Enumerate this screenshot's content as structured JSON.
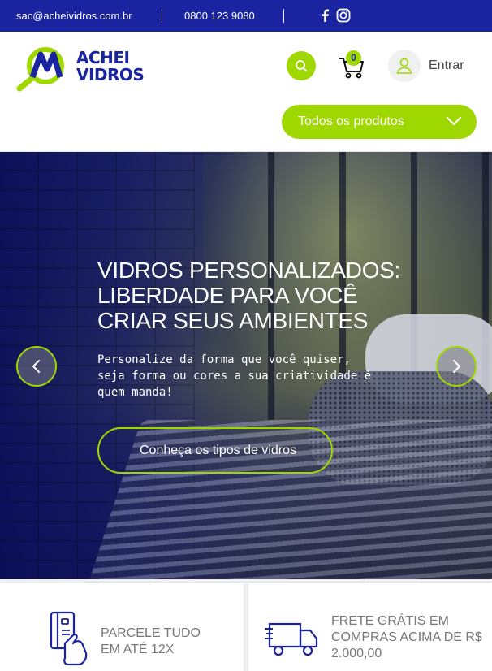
{
  "topbar": {
    "email": "sac@acheividros.com.br",
    "phone": "0800 123 9080",
    "social": [
      "facebook-icon",
      "instagram-icon"
    ]
  },
  "header": {
    "logo_text_line1": "ACHEI",
    "logo_text_line2": "VIDROS",
    "cart_count": "0",
    "login_label": "Entrar",
    "products_button_label": "Todos os produtos"
  },
  "hero": {
    "title": "VIDROS PERSONALIZADOS: LIBERDADE PARA VOCÊ CRIAR SEUS AMBIENTES",
    "subtitle": "Personalize da forma que você quiser, seja forma ou cores a sua criatividade é quem manda!",
    "cta_label": "Conheça os tipos de vidros"
  },
  "benefits": [
    {
      "icon": "card-in-hand-icon",
      "text": "PARCELE TUDO EM ATÉ 12X"
    },
    {
      "icon": "delivery-truck-icon",
      "text": "FRETE GRÁTIS EM COMPRAS ACIMA DE R$ 2.000,00"
    }
  ],
  "colors": {
    "brand_blue": "#1a24a0",
    "accent_green": "#9fd800",
    "text_gray": "#777777"
  }
}
